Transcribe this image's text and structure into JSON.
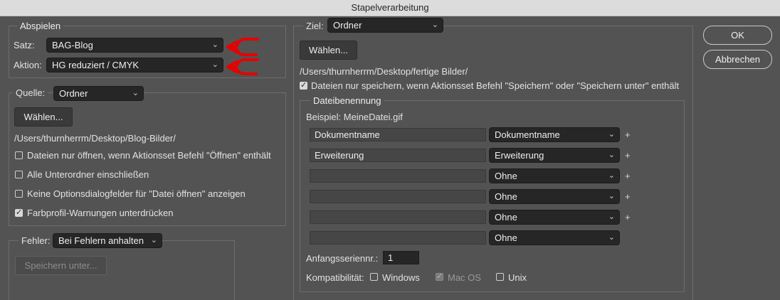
{
  "window": {
    "title": "Stapelverarbeitung"
  },
  "abspielen": {
    "title": "Abspielen",
    "satz_label": "Satz:",
    "satz_value": "BAG-Blog",
    "aktion_label": "Aktion:",
    "aktion_value": "HG reduziert / CMYK",
    "annotation_color": "#e60000"
  },
  "quelle": {
    "label": "Quelle:",
    "value": "Ordner",
    "choose_label": "Wählen...",
    "path": "/Users/thurnherrm/Desktop/Blog-Bilder/",
    "options": [
      {
        "label": "Dateien nur öffnen, wenn Aktionsset Befehl \"Öffnen\" enthält",
        "checked": false
      },
      {
        "label": "Alle Unterordner einschließen",
        "checked": false
      },
      {
        "label": "Keine Optionsdialogfelder für \"Datei öffnen\" anzeigen",
        "checked": false
      },
      {
        "label": "Farbprofil-Warnungen unterdrücken",
        "checked": true
      }
    ]
  },
  "fehler": {
    "label": "Fehler:",
    "value": "Bei Fehlern anhalten",
    "save_as_label": "Speichern unter..."
  },
  "ziel": {
    "label": "Ziel:",
    "value": "Ordner",
    "choose_label": "Wählen...",
    "path": "/Users/thurnherrm/Desktop/fertige Bilder/",
    "save_only_label": "Dateien nur speichern, wenn Aktionsset Befehl \"Speichern\" oder \"Speichern unter\" enthält",
    "save_only_checked": true
  },
  "dateibenennung": {
    "title": "Dateibenennung",
    "example": "Beispiel: MeineDatei.gif",
    "rows": [
      {
        "text": "Dokumentname",
        "select": "Dokumentname",
        "plus": "+"
      },
      {
        "text": "Erweiterung",
        "select": "Erweiterung",
        "plus": "+"
      },
      {
        "text": "",
        "select": "Ohne",
        "plus": "+"
      },
      {
        "text": "",
        "select": "Ohne",
        "plus": "+"
      },
      {
        "text": "",
        "select": "Ohne",
        "plus": "+"
      },
      {
        "text": "",
        "select": "Ohne",
        "plus": ""
      }
    ],
    "serial_label": "Anfangsseriennr.:",
    "serial_value": "1",
    "compat_label": "Kompatibilität:",
    "compat": [
      {
        "label": "Windows",
        "checked": false,
        "disabled": false
      },
      {
        "label": "Mac OS",
        "checked": true,
        "disabled": true
      },
      {
        "label": "Unix",
        "checked": false,
        "disabled": false
      }
    ]
  },
  "buttons": {
    "ok": "OK",
    "cancel": "Abbrechen"
  }
}
